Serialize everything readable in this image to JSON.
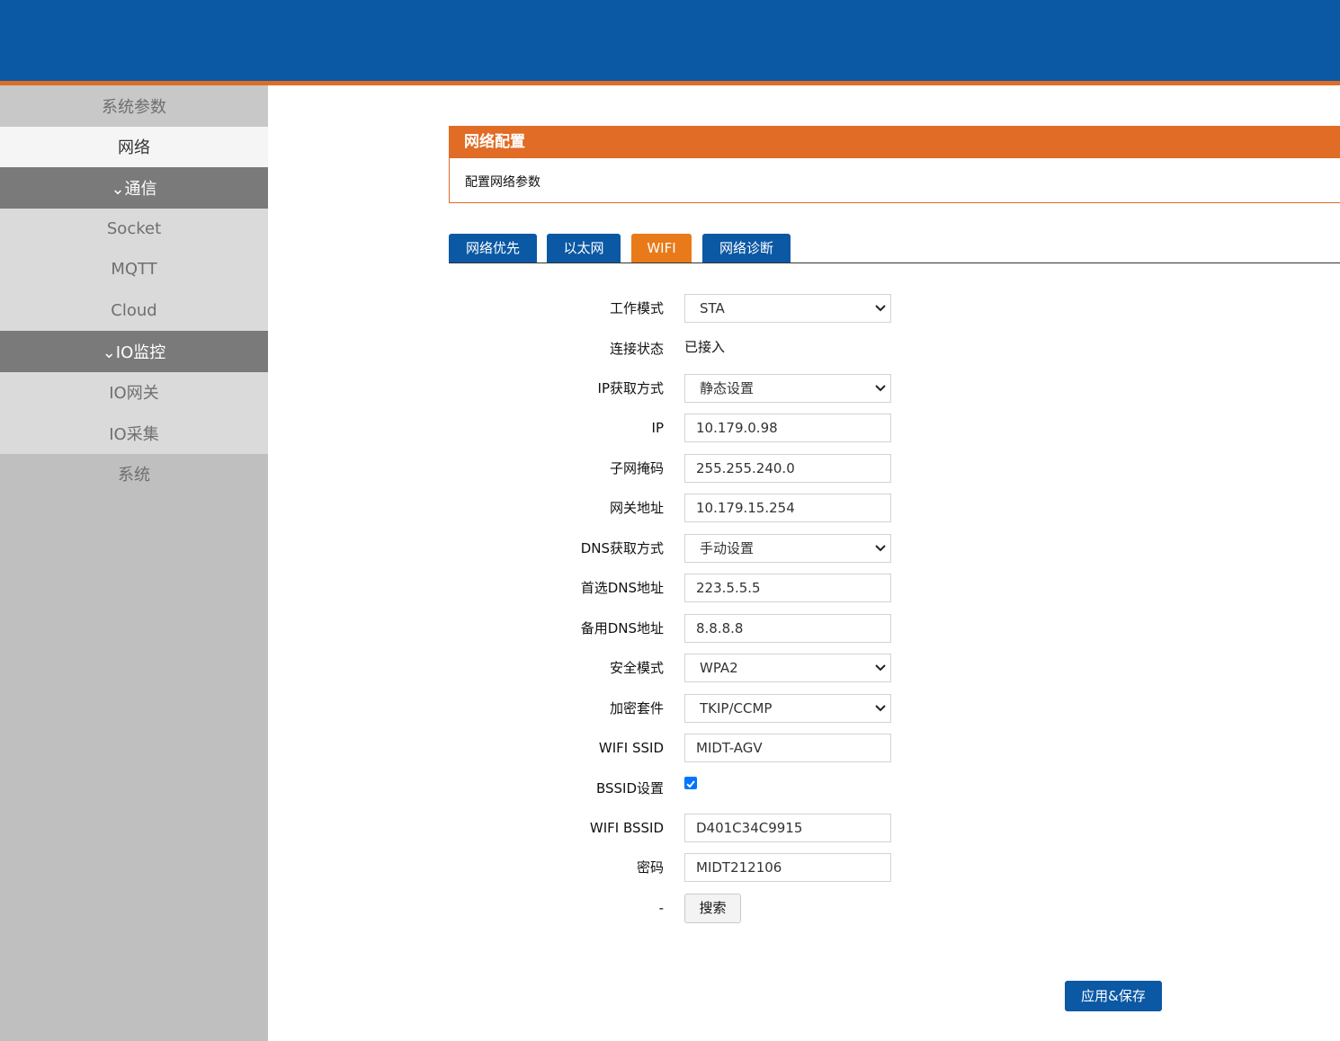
{
  "sidebar": {
    "items": [
      {
        "label": "系统参数"
      },
      {
        "label": "网络"
      },
      {
        "label": "⌄通信"
      },
      {
        "label": "Socket"
      },
      {
        "label": "MQTT"
      },
      {
        "label": "Cloud"
      },
      {
        "label": "⌄IO监控"
      },
      {
        "label": "IO网关"
      },
      {
        "label": "IO采集"
      },
      {
        "label": "系统"
      }
    ]
  },
  "panel": {
    "title": "网络配置",
    "description": "配置网络参数"
  },
  "tabs": [
    {
      "label": "网络优先"
    },
    {
      "label": "以太网"
    },
    {
      "label": "WIFI",
      "active": true
    },
    {
      "label": "网络诊断"
    }
  ],
  "form": {
    "work_mode": {
      "label": "工作模式",
      "value": "STA"
    },
    "conn_status": {
      "label": "连接状态",
      "value": "已接入"
    },
    "ip_mode": {
      "label": "IP获取方式",
      "value": "静态设置"
    },
    "ip": {
      "label": "IP",
      "value": "10.179.0.98"
    },
    "subnet": {
      "label": "子网掩码",
      "value": "255.255.240.0"
    },
    "gateway": {
      "label": "网关地址",
      "value": "10.179.15.254"
    },
    "dns_mode": {
      "label": "DNS获取方式",
      "value": "手动设置"
    },
    "dns1": {
      "label": "首选DNS地址",
      "value": "223.5.5.5"
    },
    "dns2": {
      "label": "备用DNS地址",
      "value": "8.8.8.8"
    },
    "security": {
      "label": "安全模式",
      "value": "WPA2"
    },
    "cipher": {
      "label": "加密套件",
      "value": "TKIP/CCMP"
    },
    "ssid": {
      "label": "WIFI SSID",
      "value": "MIDT-AGV"
    },
    "bssid_enable": {
      "label": "BSSID设置",
      "checked": true
    },
    "bssid": {
      "label": "WIFI BSSID",
      "value": "D401C34C9915"
    },
    "password": {
      "label": "密码",
      "value": "MIDT212106"
    },
    "search": {
      "label": "-",
      "button": "搜索"
    }
  },
  "apply_button": "应用&保存",
  "colors": {
    "header_blue": "#0b58a4",
    "accent_orange": "#e06c25",
    "tab_active": "#e87a1a",
    "sidebar_gray": "#bfbfbf"
  }
}
